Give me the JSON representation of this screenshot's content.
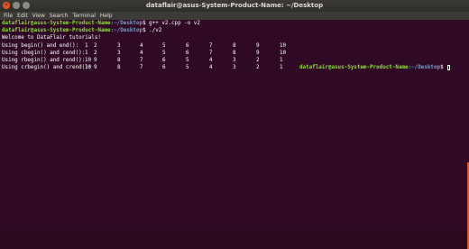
{
  "window": {
    "title": "dataflair@asus-System-Product-Name: ~/Desktop",
    "close_glyph": "×"
  },
  "menu": [
    "File",
    "Edit",
    "View",
    "Search",
    "Terminal",
    "Help"
  ],
  "terminal": {
    "prompt1": {
      "user": "dataflair@asus-System-Product-Name",
      "path": ":~/Desktop",
      "command": "$ g++ v2.cpp -o v2"
    },
    "prompt2": {
      "user": "dataflair@asus-System-Product-Name",
      "path": ":~/Desktop",
      "command": "$ ./v2"
    },
    "welcome": "Welcome to DataFlair tutorials!",
    "rows": [
      {
        "label": "Using begin() and end():",
        "values": [
          "1",
          "2",
          "3",
          "4",
          "5",
          "6",
          "7",
          "8",
          "9",
          "10"
        ]
      },
      {
        "label": "Using cbegin() and cend():",
        "values": [
          "1",
          "2",
          "3",
          "4",
          "5",
          "6",
          "7",
          "8",
          "9",
          "10"
        ]
      },
      {
        "label": "Using rbegin() and rend():",
        "values": [
          "10",
          "9",
          "8",
          "7",
          "6",
          "5",
          "4",
          "3",
          "2",
          "1"
        ]
      },
      {
        "label": "Using crbegin() and crend():",
        "values": [
          "10",
          "9",
          "8",
          "7",
          "6",
          "5",
          "4",
          "3",
          "2",
          "1"
        ]
      }
    ],
    "prompt3": {
      "user": "dataflair@asus-System-Product-Name",
      "path": ":~/Desktop",
      "command": "$ "
    }
  }
}
